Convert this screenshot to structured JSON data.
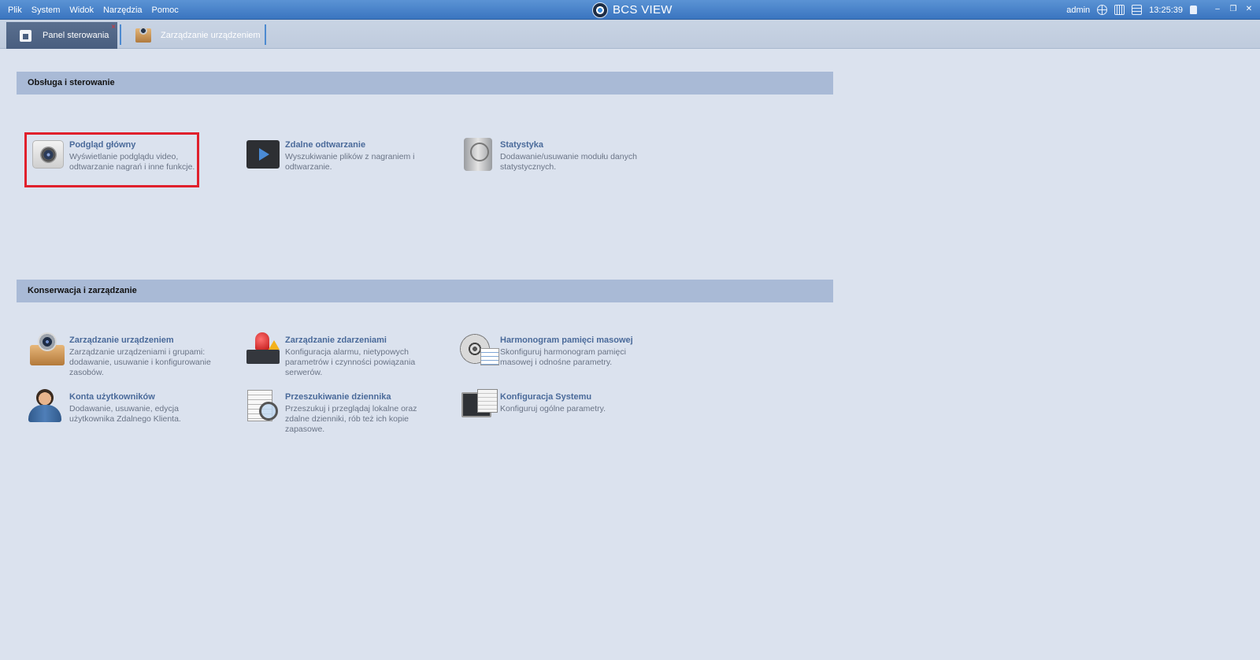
{
  "menu": [
    "Plik",
    "System",
    "Widok",
    "Narzędzia",
    "Pomoc"
  ],
  "app": {
    "title": "BCS VIEW"
  },
  "status": {
    "user": "admin",
    "time": "13:25:39"
  },
  "window": {
    "minimize": "–",
    "restore": "❐",
    "close": "✕"
  },
  "tabs": [
    {
      "label": "Panel sterowania",
      "active": true,
      "close": "×"
    },
    {
      "label": "Zarządzanie urządzeniem",
      "active": false
    }
  ],
  "sections": [
    {
      "title": "Obsługa i sterowanie",
      "items": [
        {
          "icon": "camera-icon",
          "title": "Podgląd główny",
          "desc": "Wyświetlanie podglądu video, odtwarzanie nagrań i inne funkcje."
        },
        {
          "icon": "play-video-icon",
          "title": "Zdalne odtwarzanie",
          "desc": "Wyszukiwanie plików z nagraniem i odtwarzanie."
        },
        {
          "icon": "hard-disk-icon",
          "title": "Statystyka",
          "desc": "Dodawanie/usuwanie modułu danych statystycznych."
        }
      ]
    },
    {
      "title": "Konserwacja i zarządzanie",
      "items": [
        {
          "icon": "device-icon",
          "title": "Zarządzanie urządzeniem",
          "desc": "Zarządzanie urządzeniami i grupami: dodawanie, usuwanie i konfigurowanie zasobów."
        },
        {
          "icon": "alarm-icon",
          "title": "Zarządzanie zdarzeniami",
          "desc": "Konfiguracja alarmu, nietypowych parametrów i czynności powiązania serwerów."
        },
        {
          "icon": "film-reel-icon",
          "title": "Harmonogram pamięci masowej",
          "desc": "Skonfiguruj harmonogram pamięci masowej i odnośne parametry."
        },
        {
          "icon": "user-icon",
          "title": "Konta użytkowników",
          "desc": "Dodawanie, usuwanie, edycja użytkownika Zdalnego Klienta."
        },
        {
          "icon": "log-search-icon",
          "title": "Przeszukiwanie dziennika",
          "desc": "Przeszukuj i przeglądaj lokalne oraz zdalne dzienniki, rób też ich kopie zapasowe."
        },
        {
          "icon": "system-config-icon",
          "title": "Konfiguracja Systemu",
          "desc": "Konfiguruj ogólne parametry."
        }
      ]
    }
  ]
}
